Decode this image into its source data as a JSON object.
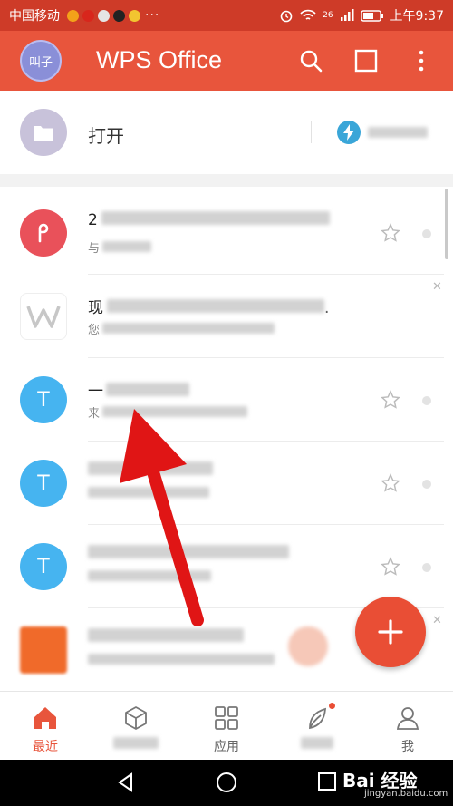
{
  "status_bar": {
    "carrier": "中国移动",
    "net": "26",
    "time": "上午9:37",
    "more": "···"
  },
  "app_bar": {
    "avatar_text": "叫子",
    "title": "WPS Office",
    "icons": [
      "search-icon",
      "multiwindow-icon",
      "more-vertical-icon"
    ]
  },
  "open_row": {
    "label": "打开",
    "icon": "folder-icon"
  },
  "files": [
    {
      "icon_letter": "",
      "icon_type": "pdf-icon",
      "color": "#e9515a",
      "line1": "2",
      "line2": "与",
      "starred": false
    },
    {
      "icon_letter": "",
      "icon_type": "wps-logo-icon",
      "color": "#ffffff",
      "line1": "现",
      "line2": "您",
      "starred": false
    },
    {
      "icon_letter": "T",
      "icon_type": "text-doc-icon",
      "color": "#46b4f0",
      "line1": "一",
      "line2": "来",
      "starred": false
    },
    {
      "icon_letter": "T",
      "icon_type": "text-doc-icon",
      "color": "#46b4f0",
      "line1": "",
      "line2": "",
      "starred": false
    },
    {
      "icon_letter": "T",
      "icon_type": "text-doc-icon",
      "color": "#46b4f0",
      "line1": "",
      "line2": "",
      "starred": false
    },
    {
      "icon_letter": "",
      "icon_type": "ad-image-icon",
      "color": "#f06a2a",
      "line1": "",
      "line2": "",
      "starred": false
    }
  ],
  "bottom_nav": [
    {
      "label": "最近",
      "icon": "home-icon",
      "active": true
    },
    {
      "label": "",
      "icon": "cube-icon",
      "active": false
    },
    {
      "label": "应用",
      "icon": "apps-grid-icon",
      "active": false
    },
    {
      "label": "",
      "icon": "leaf-icon",
      "active": false,
      "badge": true
    },
    {
      "label": "我",
      "icon": "user-icon",
      "active": false
    }
  ],
  "watermark": {
    "brand": "Bai 经验",
    "url": "jingyan.baidu.com"
  },
  "colors": {
    "app_bar": "#e8553c",
    "status_bar": "#ce3b28",
    "accent": "#e8553c",
    "fab": "#e94e35",
    "annotation_arrow": "#e01515"
  }
}
